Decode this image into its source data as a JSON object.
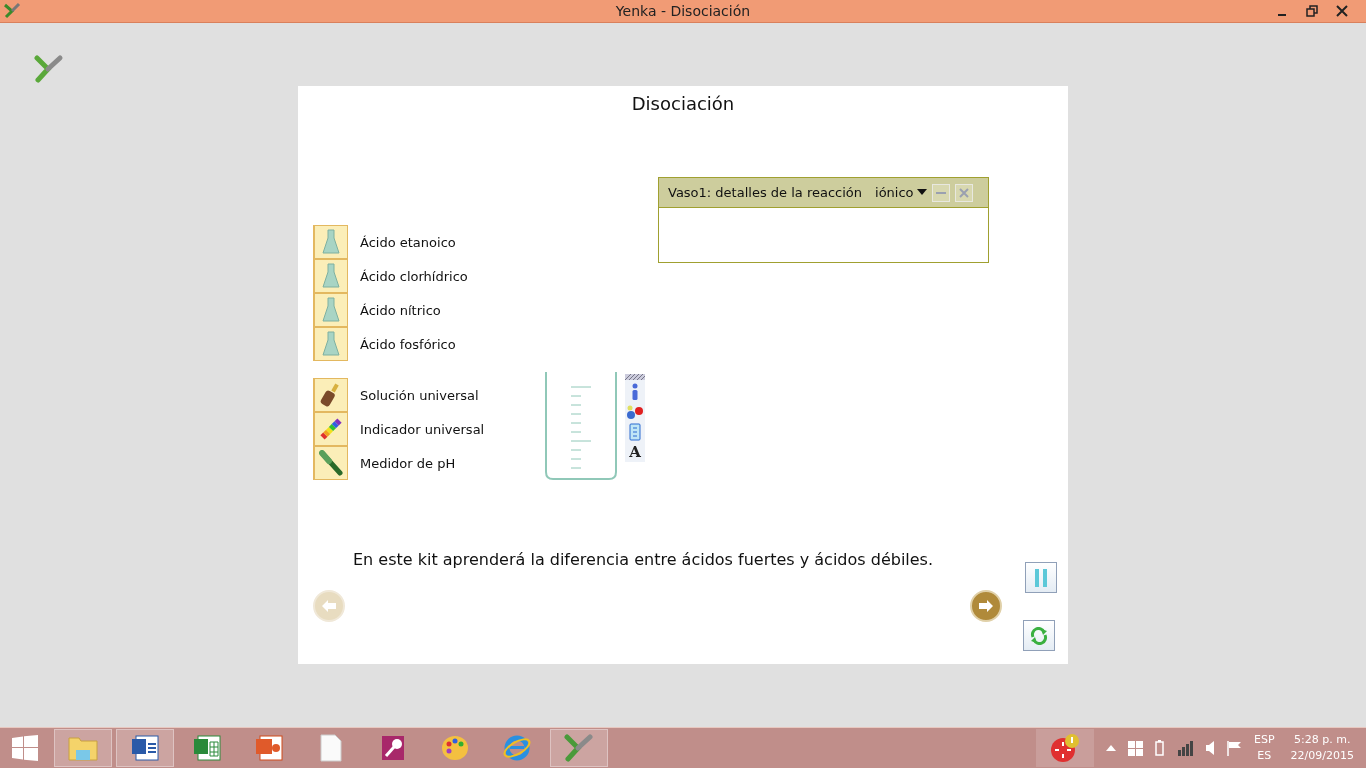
{
  "window": {
    "title": "Yenka - Disociación"
  },
  "stage": {
    "title": "Disociación",
    "tool_groups": [
      {
        "items": [
          {
            "kind": "flask",
            "label": "Ácido etanoico"
          },
          {
            "kind": "flask",
            "label": "Ácido clorhídrico"
          },
          {
            "kind": "flask",
            "label": "Ácido nítrico"
          },
          {
            "kind": "flask",
            "label": "Ácido fosfórico"
          }
        ]
      },
      {
        "items": [
          {
            "kind": "bottle",
            "label": "Solución universal"
          },
          {
            "kind": "strip",
            "label": "Indicador universal"
          },
          {
            "kind": "meter",
            "label": "Medidor de pH"
          }
        ]
      }
    ],
    "beaker_tools": {
      "text_tool": "A"
    },
    "reaction_panel": {
      "title": "Vaso1: detalles de la reacción",
      "mode": "iónico"
    },
    "message": "En este kit aprenderá la diferencia entre ácidos fuertes y ácidos débiles.",
    "back_enabled": false,
    "next_enabled": true
  },
  "taskbar": {
    "apps": [
      {
        "kind": "explorer",
        "open": true
      },
      {
        "kind": "word",
        "open": true
      },
      {
        "kind": "excel",
        "open": false
      },
      {
        "kind": "powerpoint",
        "open": false
      },
      {
        "kind": "file",
        "open": false
      },
      {
        "kind": "access",
        "open": false
      },
      {
        "kind": "paint",
        "open": false
      },
      {
        "kind": "ie",
        "open": false
      },
      {
        "kind": "yenka",
        "open": true
      }
    ],
    "language": "ESP",
    "layout": "ES",
    "time": "5:28 p. m.",
    "date": "22/09/2015"
  }
}
